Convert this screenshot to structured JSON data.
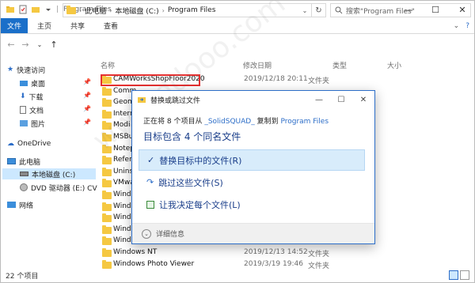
{
  "titlebar": {
    "separator": "|",
    "title": "Program Files",
    "minimize": "—",
    "maximize": "☐",
    "close": "✕"
  },
  "ribbon": {
    "tabs": [
      "文件",
      "主页",
      "共享",
      "查看"
    ],
    "help": "?"
  },
  "nav": {
    "breadcrumb": [
      "此电脑",
      "本地磁盘 (C:)",
      "Program Files"
    ],
    "search_placeholder": "搜索\"Program Files\""
  },
  "sidebar": {
    "items": [
      {
        "label": "快速访问",
        "icon": "star-icon"
      },
      {
        "label": "桌面",
        "icon": "desktop-icon",
        "pinned": true
      },
      {
        "label": "下载",
        "icon": "download-icon",
        "pinned": true
      },
      {
        "label": "文档",
        "icon": "document-icon",
        "pinned": true
      },
      {
        "label": "图片",
        "icon": "picture-icon",
        "pinned": true
      },
      {
        "label": "OneDrive",
        "icon": "cloud-icon"
      },
      {
        "label": "此电脑",
        "icon": "computer-icon"
      },
      {
        "label": "本地磁盘 (C:)",
        "icon": "drive-icon",
        "selected": true
      },
      {
        "label": "DVD 驱动器 (E:) CV",
        "icon": "dvd-icon"
      },
      {
        "label": "网络",
        "icon": "network-icon"
      }
    ]
  },
  "columns": {
    "name": "名称",
    "date": "修改日期",
    "type": "类型",
    "size": "大小"
  },
  "files": [
    {
      "name": "CAMWorksShopFloor2020",
      "date": "2019/12/18 20:11",
      "type": "文件夹"
    },
    {
      "name": "Comm",
      "date": "",
      "type": ""
    },
    {
      "name": "Geom",
      "date": "",
      "type": ""
    },
    {
      "name": "Intern",
      "date": "",
      "type": ""
    },
    {
      "name": "Modi",
      "date": "",
      "type": ""
    },
    {
      "name": "MSBu",
      "date": "",
      "type": ""
    },
    {
      "name": "Notep",
      "date": "",
      "type": ""
    },
    {
      "name": "Refer",
      "date": "",
      "type": ""
    },
    {
      "name": "Unins",
      "date": "",
      "type": ""
    },
    {
      "name": "VMwa",
      "date": "",
      "type": ""
    },
    {
      "name": "Wind",
      "date": "",
      "type": ""
    },
    {
      "name": "Wind",
      "date": "",
      "type": ""
    },
    {
      "name": "Wind",
      "date": "",
      "type": ""
    },
    {
      "name": "Wind",
      "date": "",
      "type": ""
    },
    {
      "name": "Wind",
      "date": "",
      "type": ""
    },
    {
      "name": "Windows NT",
      "date": "2019/12/13 14:52",
      "type": "文件夹"
    },
    {
      "name": "Windows Photo Viewer",
      "date": "2019/3/19 19:46",
      "type": "文件夹"
    }
  ],
  "status": {
    "count": "22 个项目"
  },
  "dialog": {
    "title": "替换或跳过文件",
    "line_prefix": "正在将 8 个项目从 ",
    "source": "_SolidSQUAD_",
    "line_mid": " 复制到 ",
    "dest": "Program Files",
    "heading": "目标包含 4 个同名文件",
    "options": [
      {
        "label": "替换目标中的文件(R)",
        "icon": "checkmark-icon"
      },
      {
        "label": "跳过这些文件(S)",
        "icon": "skip-icon"
      },
      {
        "label": "让我决定每个文件(L)",
        "icon": "compare-icon"
      }
    ],
    "details": "详细信息"
  }
}
